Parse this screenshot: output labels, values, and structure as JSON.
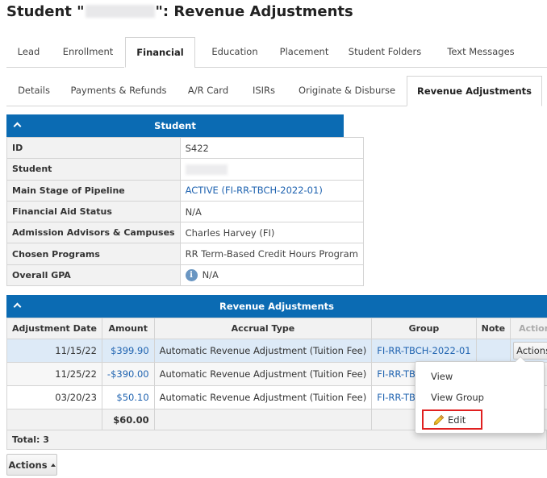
{
  "page": {
    "title_prefix": "Student \"",
    "title_suffix": "\": Revenue Adjustments"
  },
  "main_tabs": [
    "Lead",
    "Enrollment",
    "Financial",
    "Education",
    "Placement",
    "Student Folders",
    "Text Messages"
  ],
  "sub_tabs": [
    "Details",
    "Payments & Refunds",
    "A/R Card",
    "ISIRs",
    "Originate & Disburse",
    "Revenue Adjustments"
  ],
  "student_panel": {
    "title": "Student",
    "rows": [
      {
        "label": "ID",
        "value": "S422"
      },
      {
        "label": "Student",
        "value": ""
      },
      {
        "label": "Main Stage of Pipeline",
        "value": "ACTIVE (FI-RR-TBCH-2022-01)"
      },
      {
        "label": "Financial Aid Status",
        "value": "N/A"
      },
      {
        "label": "Admission Advisors & Campuses",
        "value": "Charles Harvey (FI)"
      },
      {
        "label": "Chosen Programs",
        "value": "RR Term-Based Credit Hours Program"
      },
      {
        "label": "Overall GPA",
        "value": "N/A"
      }
    ]
  },
  "revenue_panel": {
    "title": "Revenue Adjustments",
    "columns": [
      "Adjustment Date",
      "Amount",
      "Accrual Type",
      "Group",
      "Note",
      "Actions"
    ],
    "rows": [
      {
        "date": "11/15/22",
        "amount": "$399.90",
        "accrual": "Automatic Revenue Adjustment (Tuition Fee)",
        "group": "FI-RR-TBCH-2022-01",
        "note": "",
        "actions": "Actions"
      },
      {
        "date": "11/25/22",
        "amount": "-$390.00",
        "accrual": "Automatic Revenue Adjustment (Tuition Fee)",
        "group": "FI-RR-TBCH",
        "note": ""
      },
      {
        "date": "03/20/23",
        "amount": "$50.10",
        "accrual": "Automatic Revenue Adjustment (Tuition Fee)",
        "group": "FI-RR-TBCH",
        "note": ""
      }
    ],
    "sum": "$60.00",
    "total": "Total: 3",
    "bottom_actions": "Actions"
  },
  "dropdown": {
    "items": [
      "View",
      "View Group",
      "Edit"
    ]
  },
  "colors": {
    "header_blue": "#0b6bb3",
    "link_blue": "#1f63b0",
    "selected_row": "#ddeaf7",
    "highlight_red": "#e02020"
  }
}
